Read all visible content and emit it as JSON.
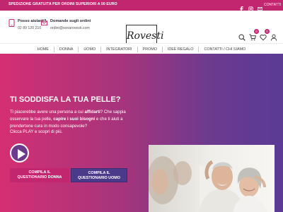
{
  "topbar": {
    "shipping": "SPEDIZIONE GRATUITA PER ORDINI SUPERIORI A 50 EURO",
    "social_icons": [
      "facebook-icon",
      "instagram-icon",
      "email-icon"
    ],
    "contatti": "CONTATTI"
  },
  "header": {
    "help_title": "Posso aiutarti?",
    "help_phone": "02 89 120 210",
    "orders_title": "Domande sugli ordini",
    "orders_email": "ordini@sonarovesti.com",
    "logo_word": "Rovesti",
    "logo_sub": "BEAUTY FARM",
    "logo_sub2": "Dalla natura alla scienza",
    "cart_count": "0",
    "wishlist_count": "0"
  },
  "nav": {
    "items": [
      "HOME",
      "DONNA",
      "UOMO",
      "INTEGRATORI",
      "PROMO",
      "IDEE REGALO",
      "CONTATTI / CHI SIAMO"
    ]
  },
  "hero": {
    "title": "TI SODDISFA LA TUA PELLE?",
    "para_1": "Ti piacerebbe avere una persona a cui ",
    "para_bold_1": "affidarti",
    "para_2": "? Che sappia osservare la tua pelle, ",
    "para_bold_2": "capire i suoi bisogni",
    "para_3": " e che ti aiuti a prendertene cura in modo consapevole?",
    "para_4": "Clicca PLAY e scopri di più.",
    "btn_donna_line1": "COMPILA IL",
    "btn_donna_line2": "QUESTIONARIO DONNA",
    "btn_uomo_line1": "COMPILA IL",
    "btn_uomo_line2": "QUESTIONARIO UOMO"
  },
  "colors": {
    "accent": "#c2266e",
    "purple": "#5a3b95"
  }
}
